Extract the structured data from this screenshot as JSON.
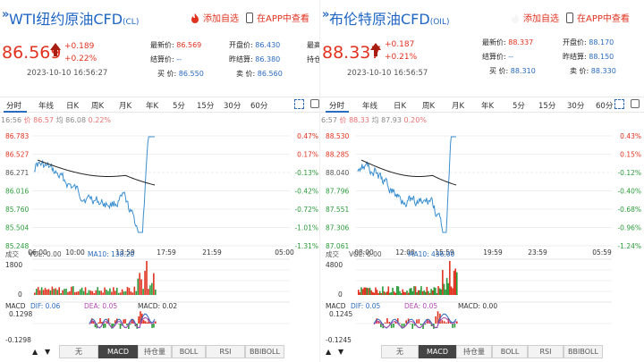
{
  "panels": [
    {
      "title": "WTI纽约原油CFD",
      "code": "(CL)",
      "favorite_label": "添加自选",
      "app_label": "在APP中查看",
      "price": "86.569",
      "change": "+0.189",
      "change_pct": "+0.22%",
      "timestamp": "2023-10-10 16:56:27",
      "quote": {
        "latest_label": "最新价:",
        "latest": "86.569",
        "open_label": "开盘价:",
        "open": "86.430",
        "settle_label": "结算价:",
        "settle": "--",
        "prev_settle_label": "昨结算:",
        "prev_settle": "86.380",
        "bid_label": "买 价:",
        "bid": "86.550",
        "ask_label": "卖 价:",
        "ask": "86.560",
        "cut_label1": "最高",
        "cut_label2": "持仓"
      },
      "tabs": [
        "分时",
        "年线",
        "日K",
        "周K",
        "月K",
        "年K",
        "5分",
        "15分",
        "30分",
        "60分"
      ],
      "info": {
        "time": "16:56",
        "price_label": "价",
        "price": "86.57",
        "avg_label": "均",
        "avg": "86.08",
        "pct": "0.22%"
      },
      "y_labels": [
        "86.783",
        "86.527",
        "86.271",
        "86.016",
        "85.760",
        "85.504",
        "85.248"
      ],
      "pct_labels": [
        "0.47%",
        "0.17%",
        "-0.13%",
        "-0.42%",
        "-0.72%",
        "-1.01%",
        "-1.31%"
      ],
      "x_labels": [
        "06:00",
        "10:00",
        "13:59",
        "17:59",
        "21:59",
        "05:00"
      ],
      "volume": {
        "label": "成交",
        "vol": "VOL: 0.00",
        "ma": "MA10: 138.20",
        "max": "1800",
        "min": "0"
      },
      "macd": {
        "label": "MACD",
        "dif": "DIF: 0.06",
        "dea": "DEA: 0.05",
        "macd": "MACD: 0.02",
        "max": "0.1298",
        "min": "-0.1298"
      },
      "bottom_tabs": [
        "无",
        "MACD",
        "持仓量",
        "BOLL",
        "RSI",
        "BBIBOLL"
      ],
      "nav_up": "▲",
      "nav_down": "▼"
    },
    {
      "title": "布伦特原油CFD",
      "code": "(OIL)",
      "favorite_label": "添加自选",
      "app_label": "在APP中查看",
      "price": "88.337",
      "change": "+0.187",
      "change_pct": "+0.21%",
      "timestamp": "2023-10-10 16:56:57",
      "quote": {
        "latest_label": "最新价:",
        "latest": "88.337",
        "open_label": "开盘价:",
        "open": "88.170",
        "settle_label": "结算价:",
        "settle": "--",
        "prev_settle_label": "昨结算:",
        "prev_settle": "88.150",
        "bid_label": "买 价:",
        "bid": "88.310",
        "ask_label": "卖 价:",
        "ask": "88.330",
        "cut_label1": "",
        "cut_label2": ""
      },
      "tabs": [
        "分时",
        "年线",
        "日K",
        "周K",
        "月K",
        "年K",
        "5分",
        "15分",
        "30分",
        "60分"
      ],
      "info": {
        "time": "6:57",
        "price_label": "价",
        "price": "88.33",
        "avg_label": "均",
        "avg": "87.93",
        "pct": "0.20%"
      },
      "y_labels": [
        "88.530",
        "88.285",
        "88.040",
        "87.796",
        "87.551",
        "87.306",
        "87.061"
      ],
      "pct_labels": [
        "0.43%",
        "0.15%",
        "-0.12%",
        "-0.40%",
        "-0.68%",
        "-0.96%",
        "-1.24%"
      ],
      "x_labels": [
        "08:00",
        "12:00",
        "15:59",
        "19:59",
        "23:59",
        "05:59"
      ],
      "volume": {
        "label": "成交",
        "vol": "VOL: 0.00",
        "ma": "MA10: 436.00",
        "max": "4800",
        "min": "0"
      },
      "macd": {
        "label": "MACD",
        "dif": "DIF: 0.05",
        "dea": "DEA: 0.05",
        "macd": "MACD: 0.00",
        "max": "0.1245",
        "min": "-0.1245"
      },
      "bottom_tabs": [
        "无",
        "MACD",
        "持仓量",
        "BOLL",
        "RSI",
        "BBIBOLL"
      ],
      "nav_up": "▲",
      "nav_down": "▼"
    }
  ],
  "colors": {
    "up": "#e0321f",
    "down": "#2a9a3a",
    "link": "#2a6bbf",
    "price_line": "#3a8fd0",
    "avg_line": "#222222"
  }
}
